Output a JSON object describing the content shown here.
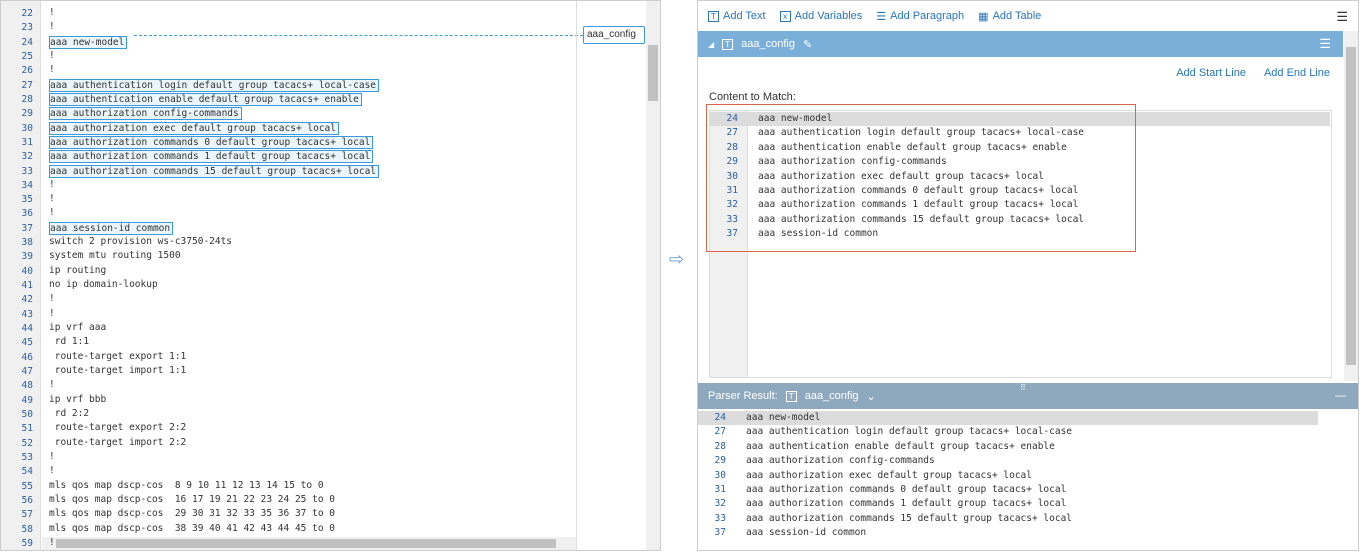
{
  "source": {
    "lines": [
      {
        "n": "22",
        "t": "!"
      },
      {
        "n": "23",
        "t": "!"
      },
      {
        "n": "24",
        "t": "aaa new-model",
        "hl": true
      },
      {
        "n": "25",
        "t": "!"
      },
      {
        "n": "26",
        "t": "!"
      },
      {
        "n": "27",
        "t": "aaa authentication login default group tacacs+ local-case",
        "hl": true
      },
      {
        "n": "28",
        "t": "aaa authentication enable default group tacacs+ enable",
        "hl": true
      },
      {
        "n": "29",
        "t": "aaa authorization config-commands",
        "hl": true
      },
      {
        "n": "30",
        "t": "aaa authorization exec default group tacacs+ local",
        "hl": true
      },
      {
        "n": "31",
        "t": "aaa authorization commands 0 default group tacacs+ local",
        "hl": true
      },
      {
        "n": "32",
        "t": "aaa authorization commands 1 default group tacacs+ local",
        "hl": true
      },
      {
        "n": "33",
        "t": "aaa authorization commands 15 default group tacacs+ local",
        "hl": true
      },
      {
        "n": "34",
        "t": "!"
      },
      {
        "n": "35",
        "t": "!"
      },
      {
        "n": "36",
        "t": "!"
      },
      {
        "n": "37",
        "t": "aaa session-id common",
        "hl": true
      },
      {
        "n": "38",
        "t": "switch 2 provision ws-c3750-24ts"
      },
      {
        "n": "39",
        "t": "system mtu routing 1500"
      },
      {
        "n": "40",
        "t": "ip routing"
      },
      {
        "n": "41",
        "t": "no ip domain-lookup"
      },
      {
        "n": "42",
        "t": "!"
      },
      {
        "n": "43",
        "t": "!"
      },
      {
        "n": "44",
        "t": "ip vrf aaa"
      },
      {
        "n": "45",
        "t": " rd 1:1"
      },
      {
        "n": "46",
        "t": " route-target export 1:1"
      },
      {
        "n": "47",
        "t": " route-target import 1:1"
      },
      {
        "n": "48",
        "t": "!"
      },
      {
        "n": "49",
        "t": "ip vrf bbb"
      },
      {
        "n": "50",
        "t": " rd 2:2"
      },
      {
        "n": "51",
        "t": " route-target export 2:2"
      },
      {
        "n": "52",
        "t": " route-target import 2:2"
      },
      {
        "n": "53",
        "t": "!"
      },
      {
        "n": "54",
        "t": "!"
      },
      {
        "n": "55",
        "t": "mls qos map dscp-cos  8 9 10 11 12 13 14 15 to 0"
      },
      {
        "n": "56",
        "t": "mls qos map dscp-cos  16 17 19 21 22 23 24 25 to 0"
      },
      {
        "n": "57",
        "t": "mls qos map dscp-cos  29 30 31 32 33 35 36 37 to 0"
      },
      {
        "n": "58",
        "t": "mls qos map dscp-cos  38 39 40 41 42 43 44 45 to 0"
      },
      {
        "n": "59",
        "t": "!"
      }
    ],
    "tag": "aaa_config"
  },
  "toolbar": {
    "add_text": "Add Text",
    "add_variables": "Add Variables",
    "add_paragraph": "Add Paragraph",
    "add_table": "Add Table"
  },
  "section": {
    "title": "aaa_config",
    "add_start_line": "Add Start Line",
    "add_end_line": "Add End Line",
    "content_label": "Content to Match:"
  },
  "matched": [
    {
      "n": "24",
      "t": "aaa new-model"
    },
    {
      "n": "27",
      "t": "aaa authentication login default group tacacs+ local-case"
    },
    {
      "n": "28",
      "t": "aaa authentication enable default group tacacs+ enable"
    },
    {
      "n": "29",
      "t": "aaa authorization config-commands"
    },
    {
      "n": "30",
      "t": "aaa authorization exec default group tacacs+ local"
    },
    {
      "n": "31",
      "t": "aaa authorization commands 0 default group tacacs+ local"
    },
    {
      "n": "32",
      "t": "aaa authorization commands 1 default group tacacs+ local"
    },
    {
      "n": "33",
      "t": "aaa authorization commands 15 default group tacacs+ local"
    },
    {
      "n": "37",
      "t": "aaa session-id common"
    }
  ],
  "parser": {
    "label": "Parser Result:",
    "selected": "aaa_config"
  }
}
